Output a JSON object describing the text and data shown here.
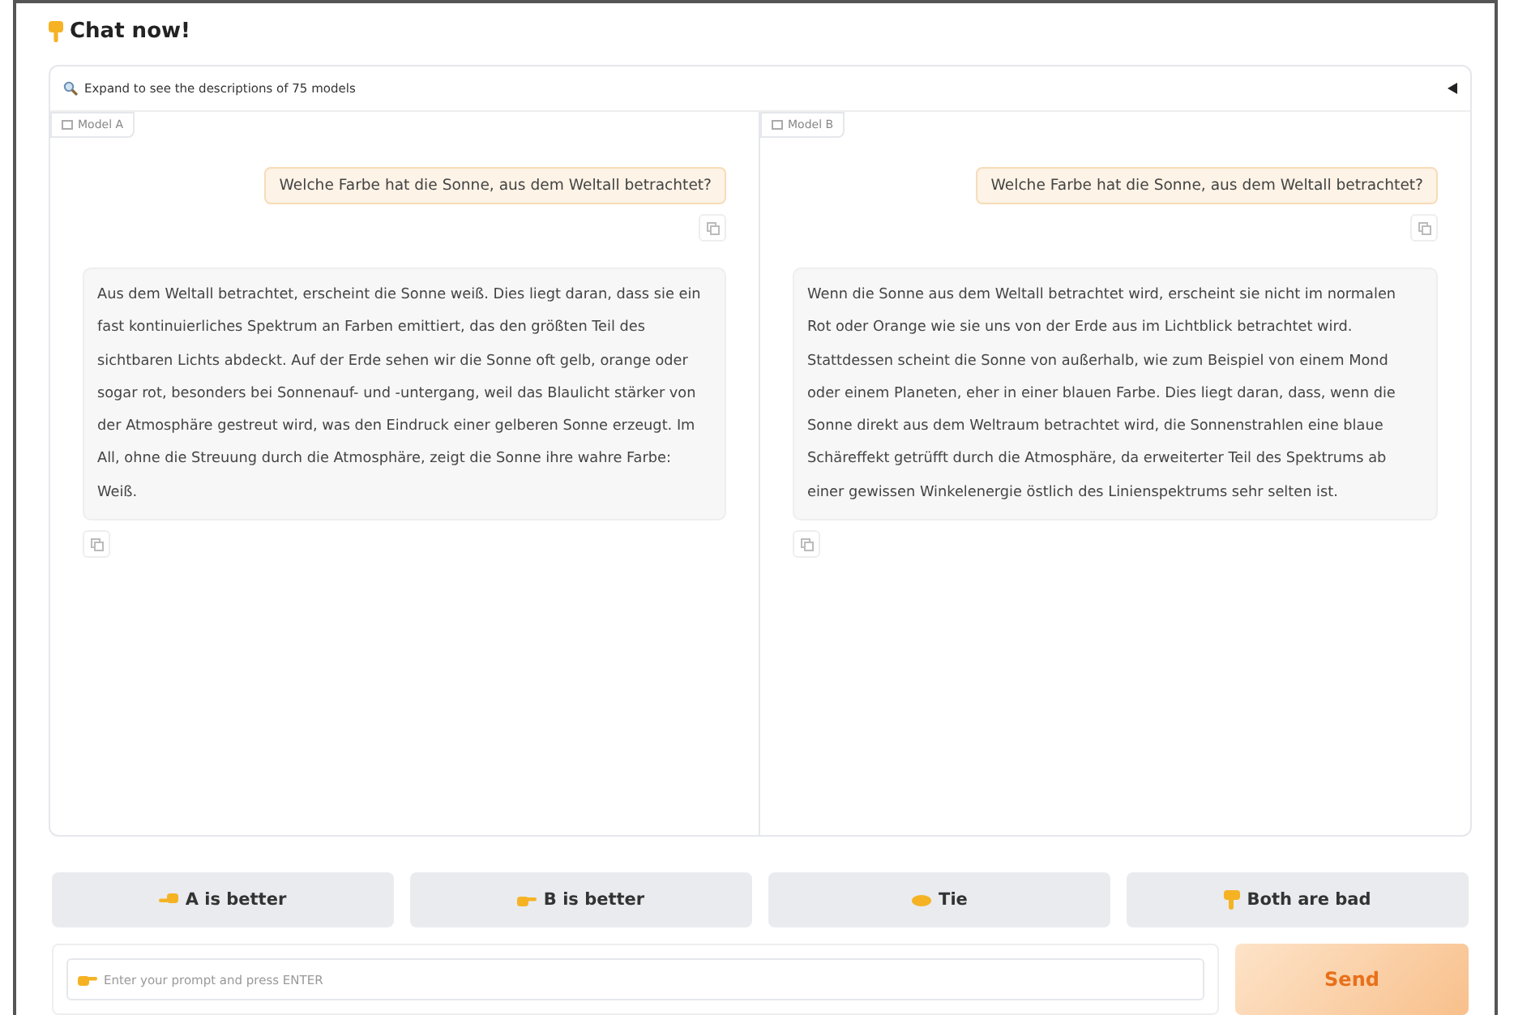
{
  "title": "Chat now!",
  "accordion": {
    "label": "Expand to see the descriptions of 75 models",
    "expanded": false
  },
  "panels": [
    {
      "label": "Model A",
      "question": "Welche Farbe hat die Sonne, aus dem Weltall betrachtet?",
      "answer": "Aus dem Weltall betrachtet, erscheint die Sonne weiß. Dies liegt daran, dass sie ein fast kontinuierliches Spektrum an Farben emittiert, das den größten Teil des sichtbaren Lichts abdeckt. Auf der Erde sehen wir die Sonne oft gelb, orange oder sogar rot, besonders bei Sonnenauf- und -untergang, weil das Blaulicht stärker von der Atmosphäre gestreut wird, was den Eindruck einer gelberen Sonne erzeugt. Im All, ohne die Streuung durch die Atmosphäre, zeigt die Sonne ihre wahre Farbe: Weiß."
    },
    {
      "label": "Model B",
      "question": "Welche Farbe hat die Sonne, aus dem Weltall betrachtet?",
      "answer": "Wenn die Sonne aus dem Weltall betrachtet wird, erscheint sie nicht im normalen Rot oder Orange wie sie uns von der Erde aus im Lichtblick betrachtet wird. Stattdessen scheint die Sonne von außerhalb, wie zum Beispiel von einem Mond oder einem Planeten, eher in einer blauen Farbe. Dies liegt daran, dass, wenn die Sonne direkt aus dem Weltraum betrachtet wird, die Sonnenstrahlen eine blaue Schäreffekt getrüfft durch die Atmosphäre, da erweiterter Teil des Spektrums ab einer gewissen Winkelenergie östlich des Linienspektrums sehr selten ist."
    }
  ],
  "vote_buttons": [
    {
      "label": "A is better",
      "kind": "left"
    },
    {
      "label": "B is better",
      "kind": "right"
    },
    {
      "label": "Tie",
      "kind": "tie"
    },
    {
      "label": "Both are bad",
      "kind": "bad"
    }
  ],
  "prompt": {
    "placeholder": "Enter your prompt and press ENTER"
  },
  "send_button": "Send"
}
